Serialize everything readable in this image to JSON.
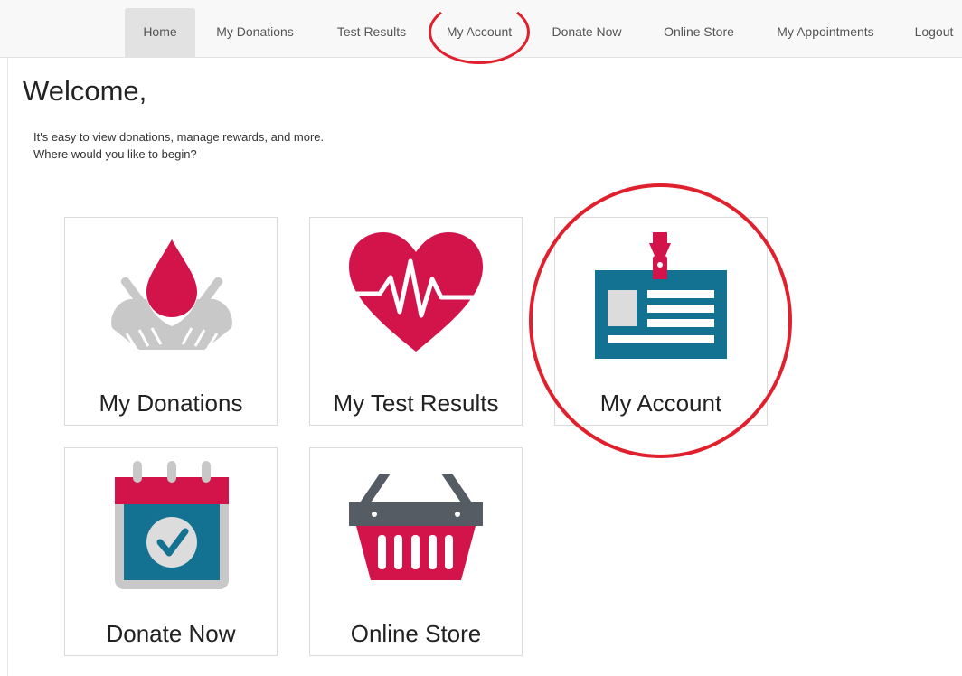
{
  "nav": {
    "items": [
      {
        "label": "Home"
      },
      {
        "label": "My Donations"
      },
      {
        "label": "Test Results"
      },
      {
        "label": "My Account"
      },
      {
        "label": "Donate Now"
      },
      {
        "label": "Online Store"
      },
      {
        "label": "My Appointments"
      },
      {
        "label": "Logout"
      }
    ],
    "active": "Home"
  },
  "welcome": {
    "heading": "Welcome,",
    "line1": "It's easy to view donations, manage rewards, and more.",
    "line2": "Where would you like to begin?"
  },
  "tiles": [
    {
      "label": "My Donations",
      "icon": "blood-drop-hands-icon"
    },
    {
      "label": "My Test Results",
      "icon": "heart-pulse-icon"
    },
    {
      "label": "My Account",
      "icon": "id-badge-icon"
    },
    {
      "label": "Donate Now",
      "icon": "calendar-check-icon"
    },
    {
      "label": "Online Store",
      "icon": "shopping-basket-icon"
    }
  ],
  "colors": {
    "brand_red": "#d3144a",
    "teal": "#137291",
    "gray_icon": "#c8c8c8",
    "annotation_red": "#e0202d"
  }
}
